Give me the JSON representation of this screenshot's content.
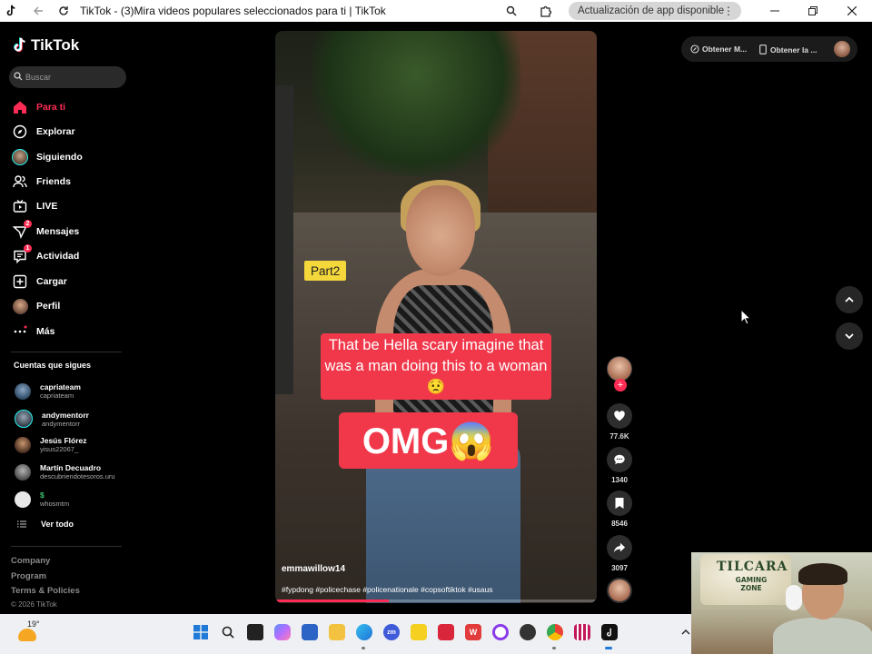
{
  "window": {
    "title": "TikTok - (3)Mira videos populares seleccionados para ti | TikTok",
    "update_pill": "Actualización de app disponible",
    "update_menu": "⋮"
  },
  "sidebar": {
    "logo": "TikTok",
    "search_placeholder": "Buscar",
    "nav": [
      {
        "label": "Para ti",
        "icon": "home-icon",
        "active": true
      },
      {
        "label": "Explorar",
        "icon": "compass-icon"
      },
      {
        "label": "Siguiendo",
        "icon": "following-avatar-icon"
      },
      {
        "label": "Friends",
        "icon": "friends-icon"
      },
      {
        "label": "LIVE",
        "icon": "live-tv-icon"
      },
      {
        "label": "Mensajes",
        "icon": "paper-plane-icon",
        "badge": "2"
      },
      {
        "label": "Actividad",
        "icon": "activity-message-icon",
        "badge": "1"
      },
      {
        "label": "Cargar",
        "icon": "plus-square-icon"
      },
      {
        "label": "Perfil",
        "icon": "profile-avatar-icon"
      },
      {
        "label": "Más",
        "icon": "more-dots-icon"
      }
    ],
    "following_title": "Cuentas que sigues",
    "following": [
      {
        "name": "capriateam",
        "handle": "capriateam"
      },
      {
        "name": "andymentorr",
        "handle": "andymentorr"
      },
      {
        "name": "Jesús Flórez",
        "handle": "yisus22067_"
      },
      {
        "name": "Martín Decuadro",
        "handle": "descubriendotesoros.uru"
      },
      {
        "name": "$",
        "handle": "whosmtm"
      }
    ],
    "see_all": "Ver todo",
    "footer": [
      "Company",
      "Program",
      "Terms & Policies"
    ],
    "copyright": "© 2026 TikTok"
  },
  "video": {
    "sticker": "Part2",
    "caption1": "That be Hella scary imagine that was a man doing this to a woman😟",
    "caption2": "OMG😱",
    "username": "emmawillow14",
    "hashtags": "#fypdong #policechase #policenationale #copsoftiktok #usaus",
    "progress": 0.35
  },
  "actions": {
    "likes": "77.6K",
    "comments": "1340",
    "saves": "8546",
    "shares": "3097",
    "follow_plus": "+"
  },
  "top_right": {
    "get_coins": "Obtener M...",
    "get_app": "Obtener la ..."
  },
  "taskbar": {
    "temperature": "19°"
  },
  "webcam": {
    "sign_line1": "TILCARA",
    "sign_line2": "GAMING ZONE"
  },
  "colors": {
    "accent": "#fe2c55",
    "caption_bg": "#f0384a",
    "sticker_bg": "#f4d73b"
  }
}
